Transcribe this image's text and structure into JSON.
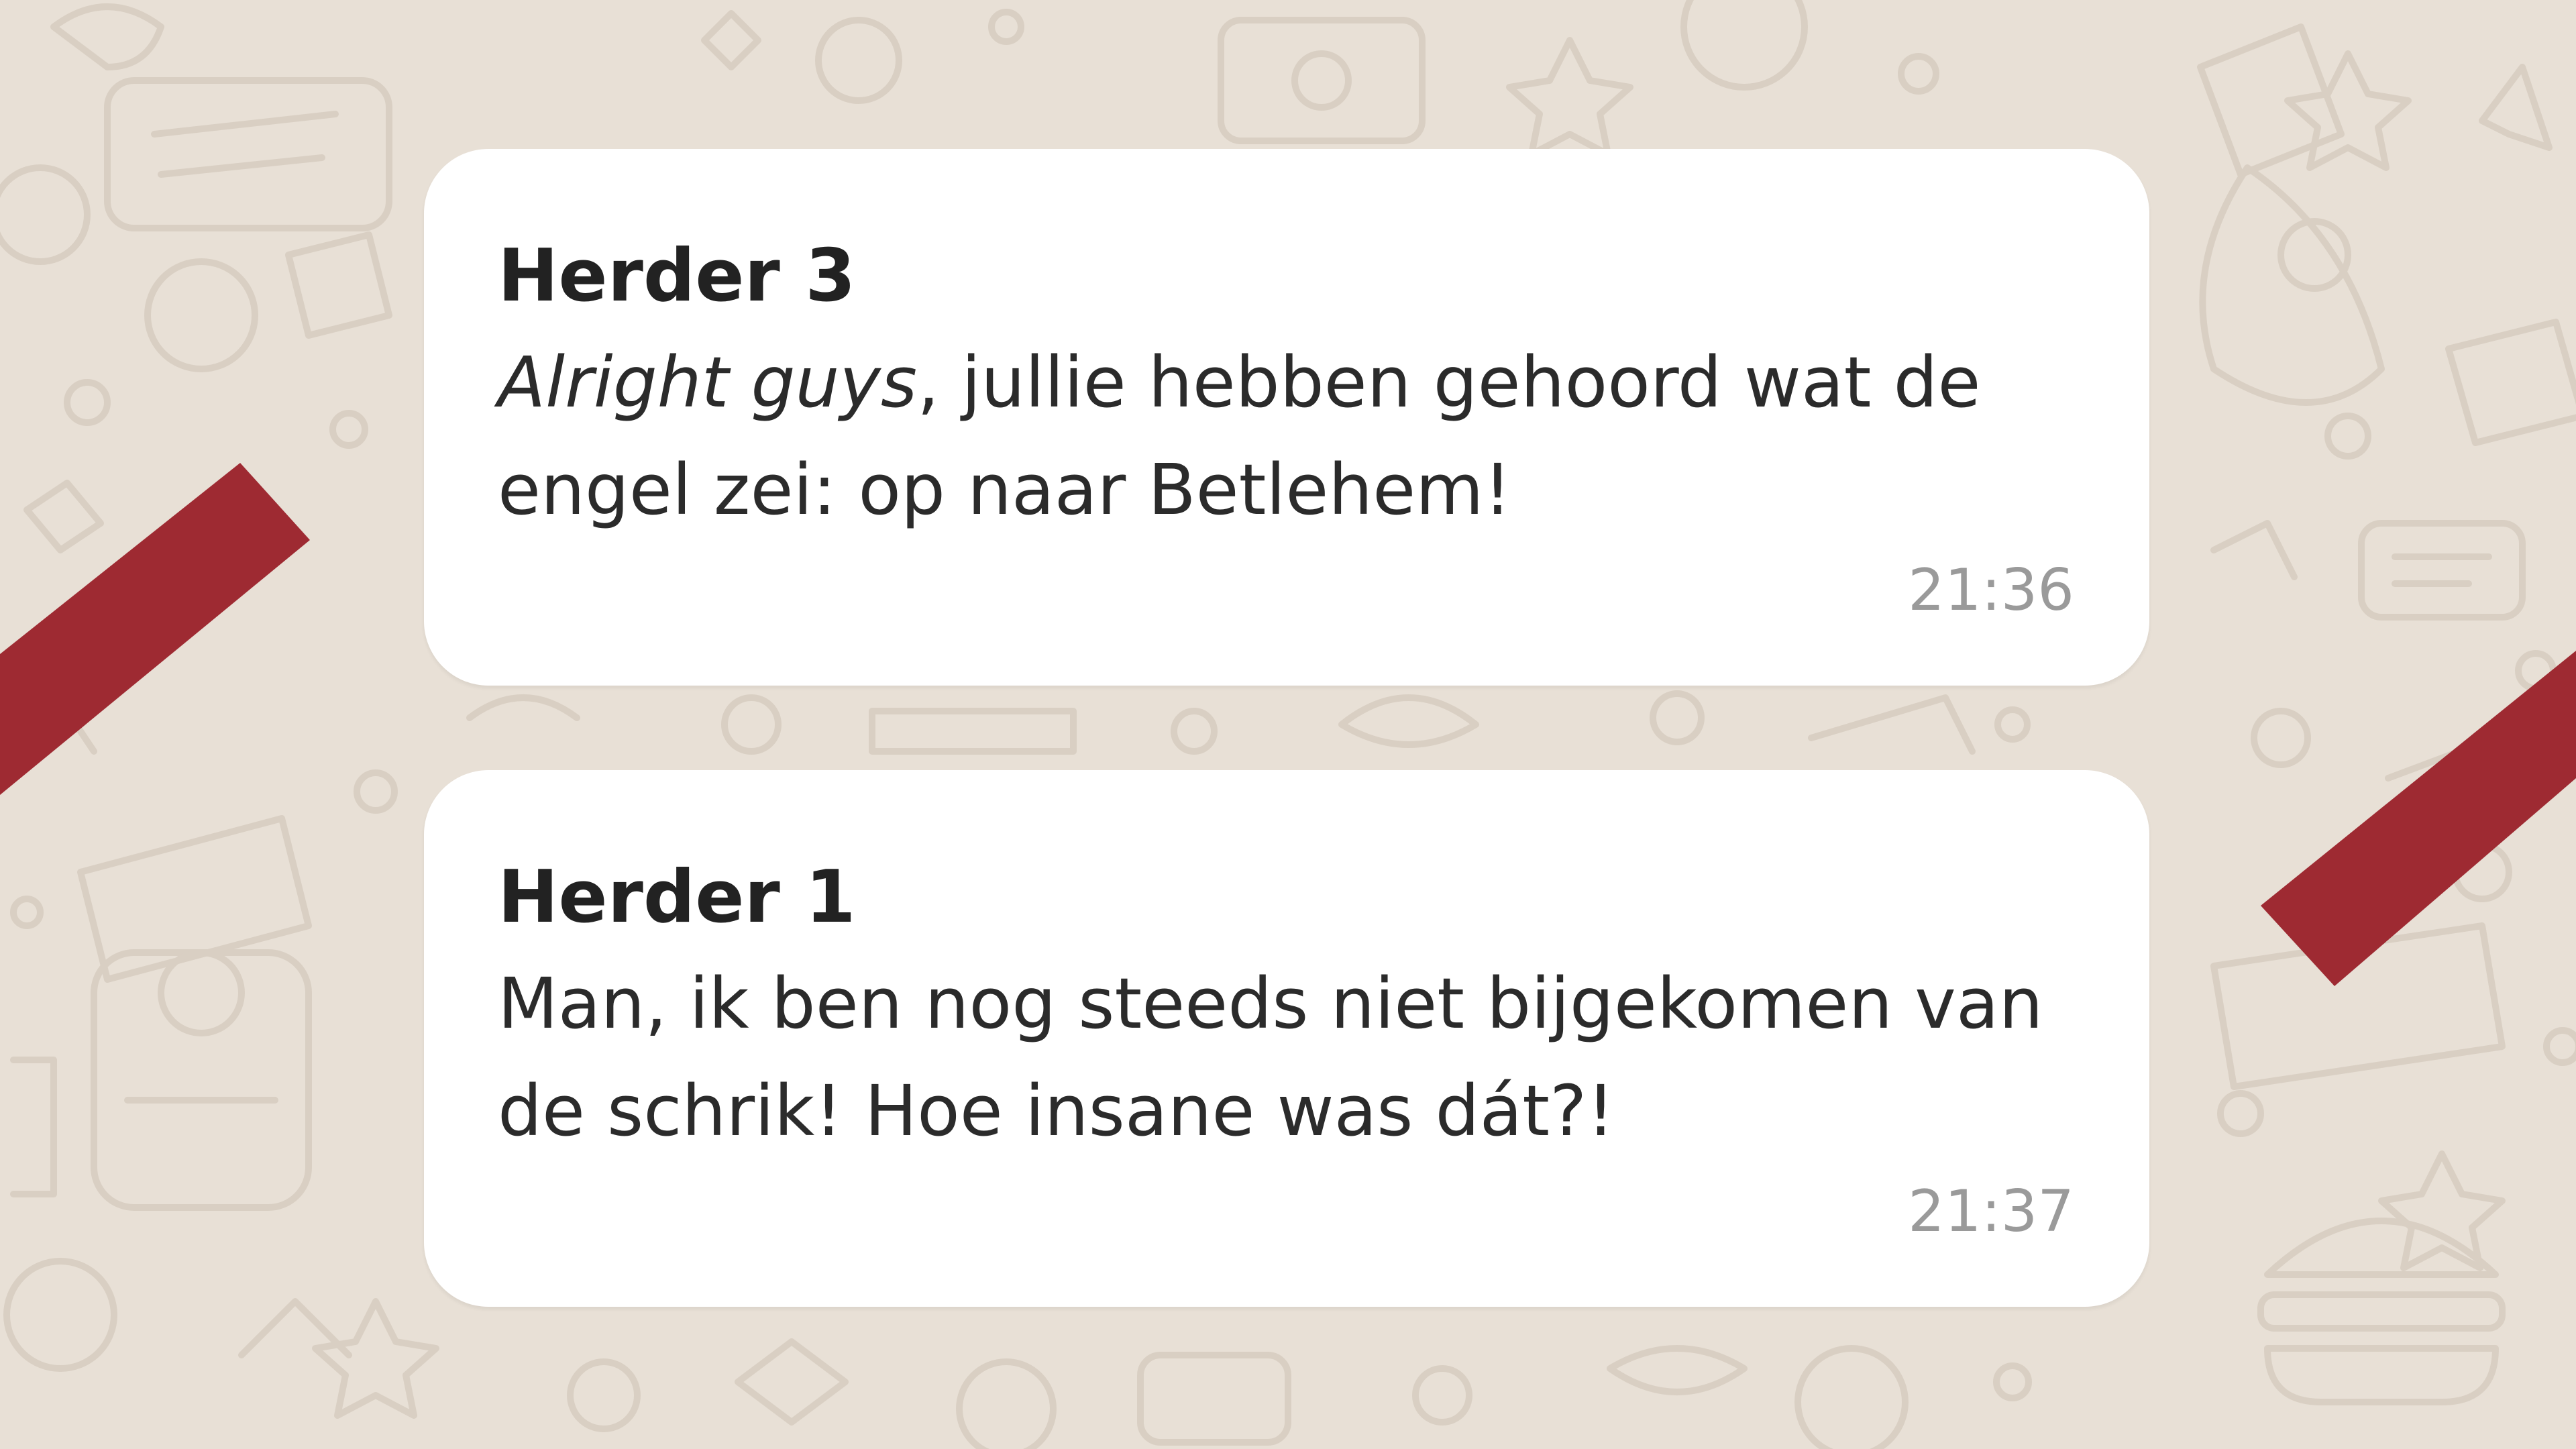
{
  "colors": {
    "background": "#e8e0d6",
    "doodle_stroke": "#d9cfc3",
    "bubble": "#ffffff",
    "accent_stripe": "#9e2a32",
    "text": "#2b2b2b",
    "timestamp": "#9a9a9a"
  },
  "messages": [
    {
      "sender": "Herder 3",
      "text_italic": "Alright guys",
      "text_rest": ", jullie hebben gehoord wat de engel zei: op naar Betlehem!",
      "time": "21:36"
    },
    {
      "sender": "Herder 1",
      "text": "Man, ik ben nog steeds niet bijgekomen van de schrik! Hoe insane was dát?!",
      "time": "21:37"
    }
  ]
}
